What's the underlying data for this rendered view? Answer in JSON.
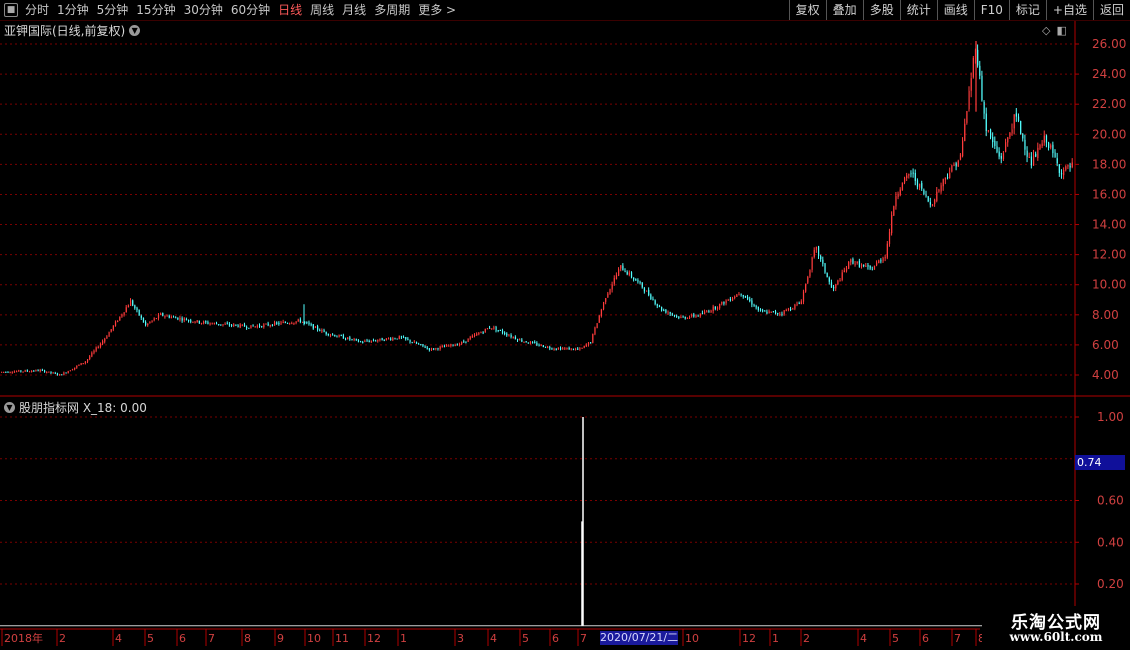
{
  "toolbar": {
    "icon": "square-menu-icon",
    "periods": [
      "分时",
      "1分钟",
      "5分钟",
      "15分钟",
      "30分钟",
      "60分钟",
      "日线",
      "周线",
      "月线",
      "多周期",
      "更多 >"
    ],
    "active_period": "日线",
    "buttons": [
      "复权",
      "叠加",
      "多股",
      "统计",
      "画线",
      "F10",
      "标记",
      "+自选",
      "返回"
    ]
  },
  "main_chart": {
    "title": "亚钾国际(日线,前复权)",
    "y_ticks": [
      "26.00",
      "24.00",
      "22.00",
      "20.00",
      "18.00",
      "16.00",
      "14.00",
      "12.00",
      "10.00",
      "8.00",
      "6.00",
      "4.00"
    ]
  },
  "indicator": {
    "title": "股朋指标网 X_18: 0.00",
    "y_ticks": [
      "1.00",
      "0.60",
      "0.40",
      "0.20"
    ],
    "current_value": "0.74"
  },
  "x_axis": {
    "labels": [
      "2018年",
      "2",
      "4",
      "5",
      "6",
      "7",
      "8",
      "9",
      "10",
      "11",
      "12",
      "1",
      "3",
      "4",
      "5",
      "6",
      "7",
      "10",
      "12",
      "1",
      "2",
      "4",
      "5",
      "6",
      "7",
      "8"
    ],
    "highlight_date": "2020/07/21/二"
  },
  "watermark": {
    "line1": "乐淘公式网",
    "line2": "www.60lt.com"
  },
  "colors": {
    "up": "#ff3c3c",
    "down": "#52ffff",
    "axis": "#b00000",
    "grid": "#7a0000",
    "highlight": "#1a1a9c"
  },
  "chart_data": {
    "type": "candlestick",
    "price_range": [
      3.0,
      26.5
    ],
    "indicator_range": [
      0,
      1.05
    ],
    "price_keypoints": [
      [
        0,
        4.2
      ],
      [
        40,
        4.3
      ],
      [
        60,
        4.0
      ],
      [
        85,
        4.9
      ],
      [
        105,
        6.5
      ],
      [
        130,
        8.9
      ],
      [
        145,
        7.3
      ],
      [
        160,
        8.0
      ],
      [
        200,
        7.5
      ],
      [
        250,
        7.2
      ],
      [
        300,
        7.6
      ],
      [
        325,
        6.8
      ],
      [
        360,
        6.2
      ],
      [
        400,
        6.5
      ],
      [
        430,
        5.7
      ],
      [
        460,
        6.1
      ],
      [
        490,
        7.2
      ],
      [
        520,
        6.3
      ],
      [
        550,
        5.8
      ],
      [
        580,
        5.7
      ],
      [
        590,
        6.2
      ],
      [
        605,
        9.2
      ],
      [
        620,
        11.2
      ],
      [
        640,
        10.0
      ],
      [
        660,
        8.4
      ],
      [
        680,
        7.8
      ],
      [
        700,
        8.0
      ],
      [
        720,
        8.7
      ],
      [
        740,
        9.5
      ],
      [
        760,
        8.2
      ],
      [
        780,
        8.1
      ],
      [
        800,
        8.8
      ],
      [
        815,
        12.5
      ],
      [
        832,
        9.6
      ],
      [
        850,
        11.6
      ],
      [
        870,
        11.0
      ],
      [
        885,
        12.0
      ],
      [
        895,
        16.0
      ],
      [
        910,
        17.5
      ],
      [
        930,
        15.3
      ],
      [
        945,
        17.2
      ],
      [
        960,
        18.5
      ],
      [
        975,
        26.0
      ],
      [
        985,
        20.5
      ],
      [
        1000,
        18.3
      ],
      [
        1015,
        21.3
      ],
      [
        1030,
        18.0
      ],
      [
        1045,
        19.8
      ],
      [
        1060,
        17.5
      ],
      [
        1075,
        18.0
      ]
    ],
    "indicator_signal": {
      "x_label": "7",
      "value": 1.0
    }
  }
}
